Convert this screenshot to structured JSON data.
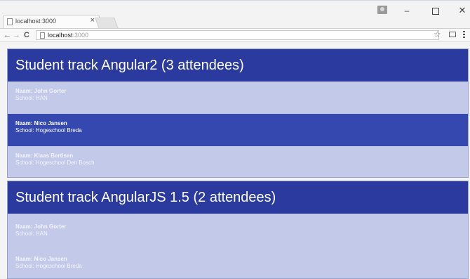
{
  "browser": {
    "tab_title": "localhost:3000",
    "tab_close": "×",
    "url_host": "localhost",
    "url_port": ":3000",
    "nav_back": "←",
    "nav_forward": "→",
    "nav_reload": "C",
    "bookmark_star": "☆",
    "window_minimize": "–",
    "window_close": "✕"
  },
  "tracks": [
    {
      "title": "Student track Angular2 (3 attendees)",
      "attendees": [
        {
          "name_label": "Naam: John Gorter",
          "school_label": "School: HAN",
          "selected": false
        },
        {
          "name_label": "Naam: Nico Jansen",
          "school_label": "School: Hogeschool Breda",
          "selected": true
        },
        {
          "name_label": "Naam: Klaas Bertisen",
          "school_label": "School: Hogeschool Den Bosch",
          "selected": false
        }
      ]
    },
    {
      "title": "Student track AngularJS 1.5 (2 attendees)",
      "attendees": [
        {
          "name_label": "Naam: John Gorter",
          "school_label": "School: HAN",
          "selected": false
        },
        {
          "name_label": "Naam: Nico Jansen",
          "school_label": "School: Hogeschool Breda",
          "selected": false
        }
      ]
    }
  ],
  "colors": {
    "header": "#2a3a9e",
    "row": "#c3c9e8",
    "row_selected": "#3448b0"
  }
}
